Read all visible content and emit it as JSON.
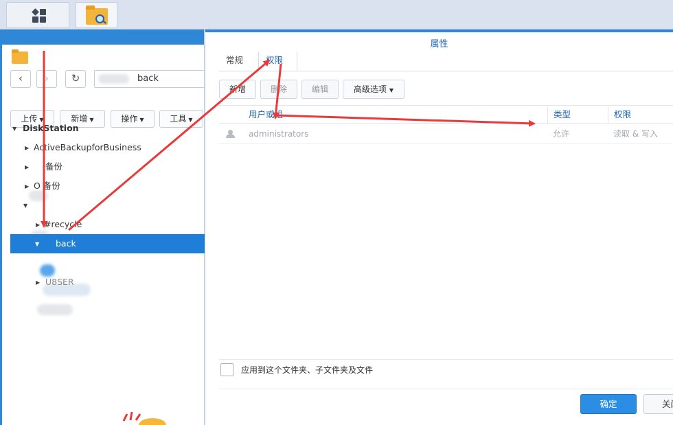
{
  "taskbar": {
    "apps_icon": "apps-grid-icon",
    "file_station_icon": "file-station-folder-icon"
  },
  "file_station": {
    "path_value": "back",
    "toolbar": {
      "upload": "上传",
      "create": "新增",
      "action": "操作",
      "tools": "工具"
    },
    "tree": {
      "root": "DiskStation",
      "items": [
        {
          "label": "ActiveBackupforBusiness"
        },
        {
          "label": "备份"
        },
        {
          "label": "O 备份"
        },
        {
          "label": "#recycle"
        },
        {
          "label": "back"
        },
        {
          "label": "U8SER"
        }
      ]
    }
  },
  "dialog": {
    "title": "属性",
    "tabs": [
      "常规",
      "权限"
    ],
    "active_tab": "权限",
    "toolbar": {
      "create": "新增",
      "delete": "删除",
      "edit": "编辑",
      "advanced": "高级选项"
    },
    "columns": {
      "user": "用户或组",
      "type": "类型",
      "permission": "权限"
    },
    "rows": [
      {
        "user": "administrators",
        "type": "允许",
        "permission": "读取 & 写入"
      }
    ],
    "apply_label": "应用到这个文件夹、子文件夹及文件",
    "ok": "确定",
    "close": "关闭"
  },
  "colors": {
    "accent": "#2f87d8",
    "selected": "#1f7fd8",
    "annotation": "#e83a3a"
  }
}
